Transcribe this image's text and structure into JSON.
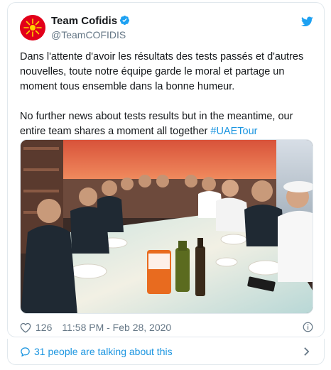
{
  "tweet": {
    "author_name": "Team Cofidis",
    "author_handle": "@TeamCOFIDIS",
    "text_fr": "Dans l'attente d'avoir les résultats des tests passés et d'autres nouvelles, toute notre équipe garde le moral et partage un moment tous ensemble dans la bonne humeur.",
    "text_en": "No further news about tests results but in the meantime, our entire team shares a moment all together ",
    "hashtag": "#UAETour",
    "likes": "126",
    "timestamp": "11:58 PM - Feb 28, 2020"
  },
  "footer": {
    "talking": "31 people are talking about this"
  },
  "colors": {
    "brand_red": "#e2001a",
    "link_blue": "#1b95e0",
    "verified_blue": "#1da1f2",
    "muted": "#657786"
  },
  "icons": [
    "cofidis-logo",
    "verified-icon",
    "twitter-bird-icon",
    "heart-icon",
    "info-icon",
    "speech-bubble-icon",
    "chevron-right-icon"
  ]
}
